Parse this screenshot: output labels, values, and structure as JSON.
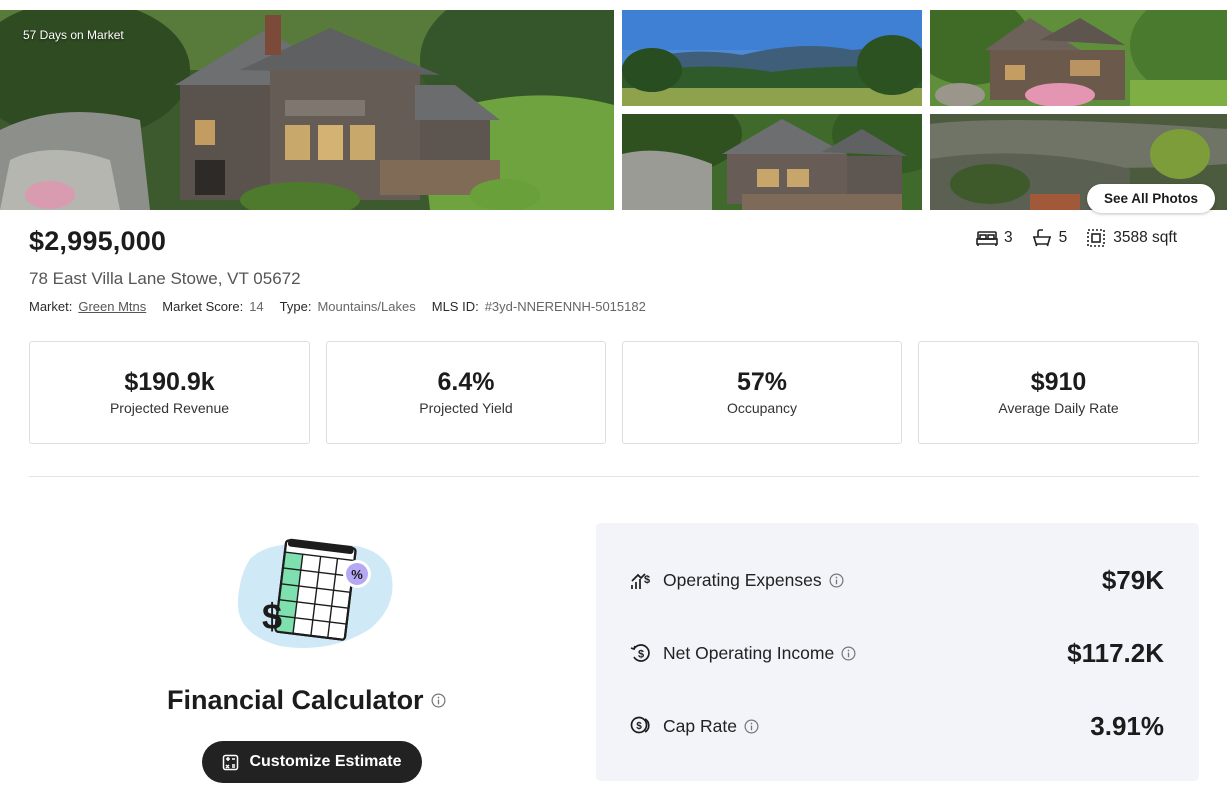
{
  "gallery": {
    "days_on_market": "57 Days on Market",
    "see_all": "See All Photos"
  },
  "listing": {
    "price": "$2,995,000",
    "address": "78 East Villa Lane Stowe, VT 05672",
    "meta": [
      {
        "label": "Market:",
        "value": "Green Mtns"
      },
      {
        "label": "Market Score:",
        "value": "14"
      },
      {
        "label": "Type:",
        "value": "Mountains/Lakes"
      },
      {
        "label": "MLS ID:",
        "value": "#3yd-NNERENNH-5015182"
      }
    ],
    "specs": {
      "beds": "3",
      "baths": "5",
      "sqft": "3588 sqft"
    }
  },
  "stats": [
    {
      "value": "$190.9k",
      "label": "Projected Revenue"
    },
    {
      "value": "6.4%",
      "label": "Projected Yield"
    },
    {
      "value": "57%",
      "label": "Occupancy"
    },
    {
      "value": "$910",
      "label": "Average Daily Rate"
    }
  ],
  "calculator": {
    "title": "Financial Calculator",
    "button": "Customize Estimate",
    "rows": [
      {
        "name": "Operating Expenses",
        "amount": "$79K",
        "icon": "chart-dollar-icon"
      },
      {
        "name": "Net Operating Income",
        "amount": "$117.2K",
        "icon": "refresh-dollar-icon"
      },
      {
        "name": "Cap Rate",
        "amount": "3.91%",
        "icon": "coins-icon"
      }
    ]
  },
  "colors": {
    "accent_dark": "#222222",
    "panel_bg": "#f3f4fa",
    "illus_blue": "#cfe9f7",
    "illus_green": "#7ee0ae",
    "illus_purple": "#b6a9f4"
  }
}
